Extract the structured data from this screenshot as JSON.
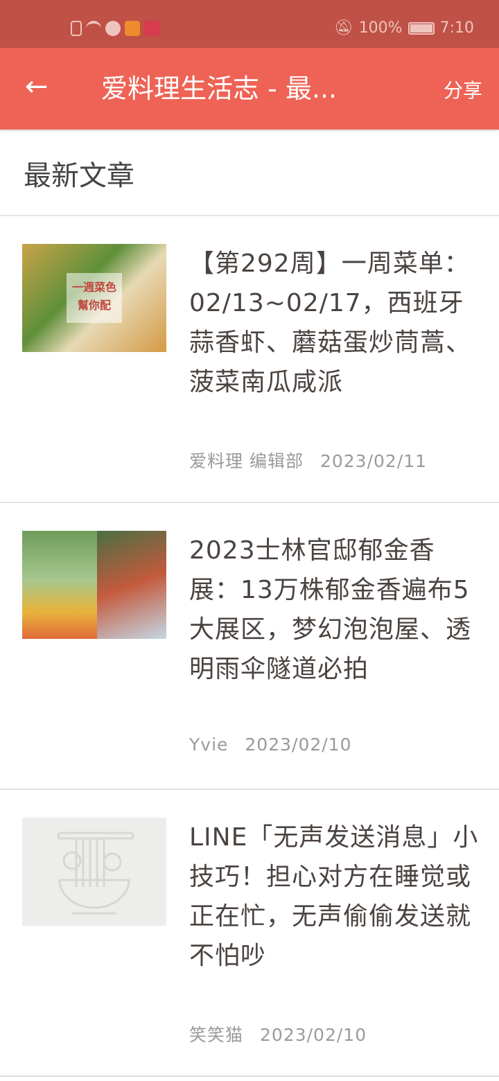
{
  "status_bar": {
    "battery": "100%",
    "time": "7:10"
  },
  "app_bar": {
    "back_icon": "arrow-left-icon",
    "title": "爱料理生活志 - 最...",
    "share_label": "分享"
  },
  "section_title": "最新文章",
  "articles": [
    {
      "title": "【第292周】一周菜单：02/13~02/17，西班牙蒜香虾、蘑菇蛋炒茼蒿、菠菜南瓜咸派",
      "author": "爱料理 编辑部",
      "date": "2023/02/11",
      "thumb_text": "一週菜色 幫你配"
    },
    {
      "title": "2023士林官邸郁金香展：13万株郁金香遍布5大展区，梦幻泡泡屋、透明雨伞隧道必拍",
      "author": "Yvie",
      "date": "2023/02/10"
    },
    {
      "title": "LINE「无声发送消息」小技巧！担心对方在睡觉或正在忙，无声偷偷发送就不怕吵",
      "author": "笑笑猫",
      "date": "2023/02/10"
    }
  ]
}
